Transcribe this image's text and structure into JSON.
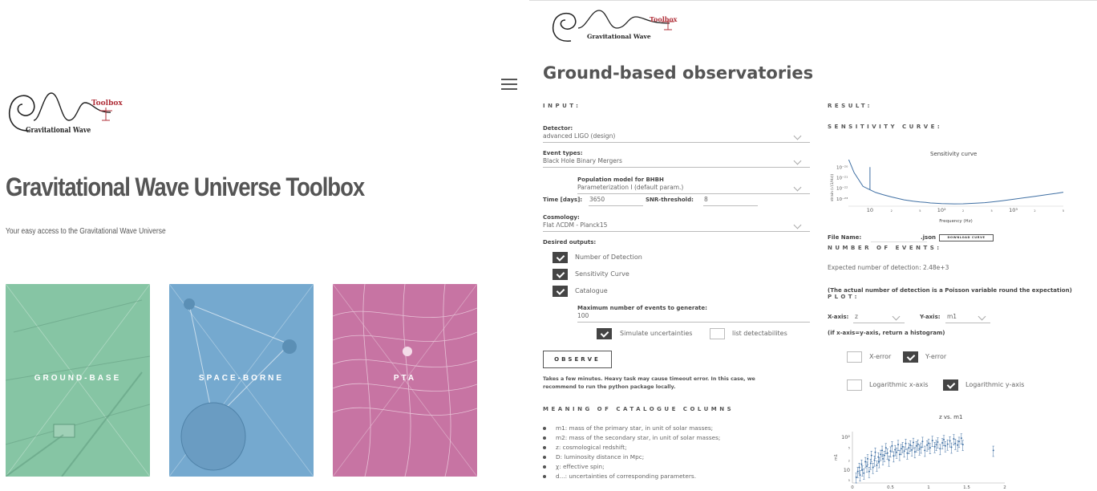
{
  "left": {
    "logo": {
      "toolbox_word": "Toolbox",
      "gw_word": "Gravitational Wave"
    },
    "title": "Gravitational Wave Universe Toolbox",
    "subtitle": "Your easy access to the Gravitational Wave Universe",
    "tiles": [
      {
        "label": "GROUND-BASE",
        "color": "#86c5a4"
      },
      {
        "label": "SPACE-BORNE",
        "color": "#75a9cf"
      },
      {
        "label": "PTA",
        "color": "#c774a3"
      }
    ]
  },
  "right": {
    "logo": {
      "toolbox_word": "Toolbox",
      "gw_word": "Gravitational Wave"
    },
    "page_title": "Ground-based observatories",
    "input_heading": "INPUT:",
    "detector": {
      "label": "Detector:",
      "value": "advanced LIGO (design)"
    },
    "event_types": {
      "label": "Event types:",
      "value": "Black Hole Binary Mergers"
    },
    "population_model": {
      "label": "Population model for BHBH",
      "value": "Parameterization I (default param.)"
    },
    "time": {
      "label": "Time [days]:",
      "value": "3650"
    },
    "snr": {
      "label": "SNR-threshold:",
      "value": "8"
    },
    "cosmology": {
      "label": "Cosmology:",
      "value": "Flat ΛCDM - Planck15"
    },
    "desired_outputs": {
      "label": "Desired outputs:",
      "items": [
        {
          "label": "Number of Detection",
          "checked": true
        },
        {
          "label": "Sensitivity Curve",
          "checked": true
        },
        {
          "label": "Catalogue",
          "checked": true
        }
      ]
    },
    "max_events": {
      "label": "Maximum number of events to generate:",
      "value": "100"
    },
    "simulate_uncertainties": {
      "label": "Simulate uncertainties",
      "checked": true
    },
    "list_detectables": {
      "label": "list detectabilites",
      "checked": false
    },
    "observe_label": "OBSERVE",
    "note_line1": "Takes a few minutes. Heavy task may cause timeout error. In this case, we",
    "note_line2": "recommend to run the python package locally.",
    "meaning_heading": "MEANING OF CATALOGUE COLUMNS",
    "meanings": [
      "m1: mass of the primary star, in unit of solar masses;",
      "m2: mass of the secondary star, in unit of solar masses;",
      "z: cosmological redshift;",
      "D: luminosity distance in Mpc;",
      "χ: effective spin;",
      "d...: uncertainties of corresponding parameters."
    ],
    "result_heading": "RESULT:",
    "sensitivity_heading": "SENSITIVITY CURVE:",
    "file_name_label": "File Name:",
    "json_label": ".json",
    "download_label": "DOWNLOAD CURVE",
    "number_heading": "NUMBER OF EVENTS:",
    "expected_text": "Expected number of detection: 2.48e+3",
    "poisson_text": "(The actual number of detection is a Poisson variable round the expectation)",
    "plot_heading": "PLOT:",
    "x_axis": {
      "label": "X-axis:",
      "value": "z"
    },
    "y_axis": {
      "label": "Y-axis:",
      "value": "m1"
    },
    "histogram_note": "(if x-axis=y-axis, return a histogram)",
    "x_error": {
      "label": "X-error",
      "checked": false
    },
    "y_error": {
      "label": "Y-error",
      "checked": true
    },
    "log_x": {
      "label": "Logarithmic x-axis",
      "checked": false
    },
    "log_y": {
      "label": "Logarithmic y-axis",
      "checked": true
    }
  },
  "chart_data": [
    {
      "type": "line",
      "title": "Sensitivity curve",
      "xlabel": "Frequency (Hz)",
      "ylabel": "strain (√(1/Hz))",
      "x_scale": "log",
      "y_scale": "log",
      "x_tick_labels": [
        "10",
        "2",
        "5",
        "10²",
        "2",
        "5",
        "10³",
        "2",
        "5"
      ],
      "y_tick_labels": [
        "10⁻²⁰",
        "10⁻²¹",
        "10⁻²²",
        "10⁻²³"
      ],
      "series": [
        {
          "x": [
            5,
            6,
            8,
            10,
            12,
            15,
            20,
            30,
            40,
            50,
            60,
            70,
            80,
            100,
            150,
            200,
            300,
            400,
            500,
            700,
            1000,
            1500,
            2000,
            3000,
            4000,
            5000
          ],
          "y": [
            6e-20,
            3e-21,
            1.5e-22,
            7e-23,
            4e-23,
            2.5e-23,
            1.5e-23,
            8e-24,
            6e-24,
            5e-24,
            4.5e-24,
            4e-24,
            3.8e-24,
            3.5e-24,
            3.3e-24,
            3.4e-24,
            3.8e-24,
            4.3e-24,
            5e-24,
            6.5e-24,
            9e-24,
            1.3e-23,
            1.7e-23,
            2.5e-23,
            3.3e-23,
            4.2e-23
          ]
        }
      ],
      "annotations": [
        {
          "note": "narrow spike near 10 Hz reaching ~1e-20"
        }
      ],
      "grid": false
    },
    {
      "type": "scatter",
      "title": "z vs. m1",
      "xlabel": "",
      "ylabel": "m1",
      "y_scale": "log",
      "x_tick_labels": [
        "0",
        "0.5",
        "1",
        "1.5",
        "2"
      ],
      "y_tick_labels": [
        "10²",
        "5",
        "2",
        "10",
        "5"
      ],
      "xlim": [
        0,
        2
      ],
      "ylim": [
        4,
        150
      ],
      "error_bars": true,
      "points": [
        [
          0.05,
          6
        ],
        [
          0.07,
          9
        ],
        [
          0.09,
          12
        ],
        [
          0.1,
          7
        ],
        [
          0.12,
          15
        ],
        [
          0.13,
          10
        ],
        [
          0.15,
          8
        ],
        [
          0.17,
          18
        ],
        [
          0.19,
          13
        ],
        [
          0.2,
          22
        ],
        [
          0.22,
          9
        ],
        [
          0.24,
          16
        ],
        [
          0.25,
          28
        ],
        [
          0.27,
          12
        ],
        [
          0.29,
          20
        ],
        [
          0.3,
          35
        ],
        [
          0.32,
          14
        ],
        [
          0.34,
          25
        ],
        [
          0.35,
          18
        ],
        [
          0.37,
          30
        ],
        [
          0.39,
          40
        ],
        [
          0.4,
          22
        ],
        [
          0.42,
          28
        ],
        [
          0.44,
          48
        ],
        [
          0.46,
          33
        ],
        [
          0.48,
          20
        ],
        [
          0.5,
          38
        ],
        [
          0.52,
          55
        ],
        [
          0.54,
          27
        ],
        [
          0.56,
          42
        ],
        [
          0.58,
          35
        ],
        [
          0.6,
          60
        ],
        [
          0.62,
          30
        ],
        [
          0.64,
          45
        ],
        [
          0.66,
          52
        ],
        [
          0.68,
          38
        ],
        [
          0.7,
          65
        ],
        [
          0.72,
          33
        ],
        [
          0.74,
          48
        ],
        [
          0.76,
          58
        ],
        [
          0.78,
          41
        ],
        [
          0.8,
          70
        ],
        [
          0.82,
          36
        ],
        [
          0.84,
          55
        ],
        [
          0.86,
          62
        ],
        [
          0.88,
          44
        ],
        [
          0.9,
          50
        ],
        [
          0.92,
          75
        ],
        [
          0.95,
          40
        ],
        [
          0.98,
          58
        ],
        [
          1.0,
          66
        ],
        [
          1.02,
          48
        ],
        [
          1.05,
          80
        ],
        [
          1.08,
          52
        ],
        [
          1.1,
          60
        ],
        [
          1.12,
          72
        ],
        [
          1.15,
          45
        ],
        [
          1.18,
          68
        ],
        [
          1.2,
          85
        ],
        [
          1.22,
          55
        ],
        [
          1.25,
          62
        ],
        [
          1.28,
          78
        ],
        [
          1.3,
          50
        ],
        [
          1.33,
          90
        ],
        [
          1.35,
          65
        ],
        [
          1.38,
          58
        ],
        [
          1.4,
          75
        ],
        [
          1.43,
          95
        ],
        [
          1.45,
          60
        ],
        [
          1.85,
          40
        ]
      ]
    }
  ]
}
